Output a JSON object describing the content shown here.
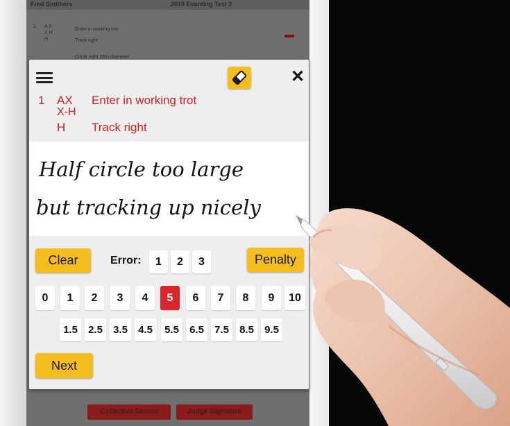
{
  "background_app": {
    "header_left": "Fred Smithers",
    "header_center": "2019 Eventing Test 2",
    "row1_num": "1",
    "row1_letters": [
      "A X",
      "X H",
      "H"
    ],
    "row1_lines": [
      "Enter in working trot",
      "Track right"
    ],
    "row2_text": "Circle right 20m diameter",
    "footer_buttons": [
      "Collective Scores",
      "Judge Signature"
    ]
  },
  "modal": {
    "movement": {
      "number": "1",
      "markers": [
        "AX",
        "X-H",
        "H"
      ],
      "directives": [
        "Enter in working trot",
        "Track right"
      ]
    },
    "handwriting_lines": [
      "Half circle too large",
      "but tracking up nicely"
    ],
    "clear_label": "Clear",
    "error_label": "Error:",
    "error_options": [
      "1",
      "2",
      "3"
    ],
    "penalty_label": "Penalty",
    "scores": [
      "0",
      "1",
      "2",
      "3",
      "4",
      "5",
      "6",
      "7",
      "8",
      "9",
      "10"
    ],
    "selected_score": "5",
    "half_scores": [
      "1.5",
      "2.5",
      "3.5",
      "4.5",
      "5.5",
      "6.5",
      "7.5",
      "8.5",
      "9.5"
    ],
    "next_label": "Next"
  },
  "colors": {
    "accent_yellow": "#f5bd1e",
    "movement_red": "#d02020",
    "selected_red": "#d8262a"
  },
  "icons": [
    "menu-icon",
    "eraser-icon",
    "close-icon"
  ]
}
